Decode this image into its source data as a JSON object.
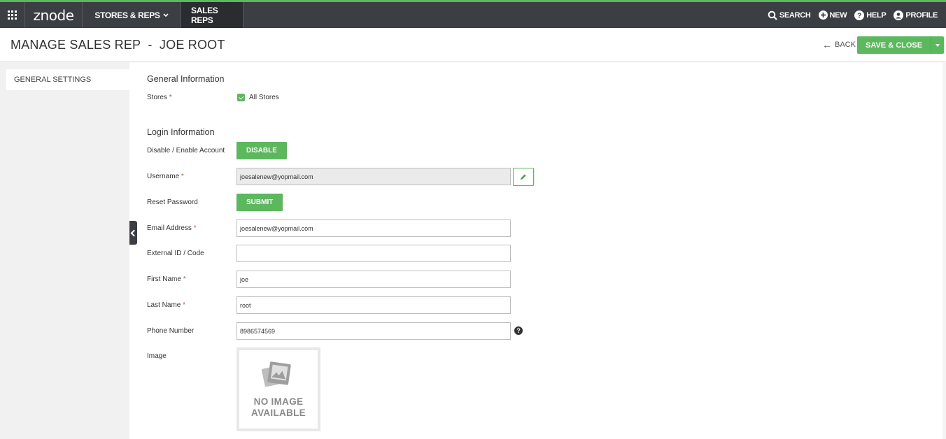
{
  "topbar": {
    "logo": "znode",
    "stores_menu": "STORES & REPS",
    "active_tab": "SALES REPS",
    "tools": {
      "search": "SEARCH",
      "new": "NEW",
      "help": "HELP",
      "profile": "PROFILE"
    }
  },
  "header": {
    "title": "MANAGE SALES REP  -  JOE ROOT",
    "back_label": "BACK",
    "save_label": "SAVE & CLOSE"
  },
  "sidebar": {
    "items": [
      {
        "label": "GENERAL SETTINGS"
      }
    ]
  },
  "general": {
    "title": "General Information",
    "stores_label": "Stores",
    "all_stores_label": "All Stores",
    "all_stores_checked": true
  },
  "login": {
    "title": "Login Information",
    "account_label": "Disable / Enable Account",
    "disable_button": "DISABLE",
    "username_label": "Username",
    "username_value": "joesalenew@yopmail.com",
    "reset_label": "Reset Password",
    "submit_button": "SUBMIT",
    "email_label": "Email Address",
    "email_value": "joesalenew@yopmail.com",
    "external_label": "External ID / Code",
    "external_value": "",
    "first_label": "First Name",
    "first_value": "joe",
    "last_label": "Last Name",
    "last_value": "root",
    "phone_label": "Phone Number",
    "phone_value": "8986574569",
    "image_label": "Image",
    "no_image_line1": "NO IMAGE",
    "no_image_line2": "AVAILABLE"
  },
  "required_mark": "*",
  "colors": {
    "accent": "#5cb85c",
    "topbar": "#3b3e42",
    "required": "#d9534f"
  }
}
